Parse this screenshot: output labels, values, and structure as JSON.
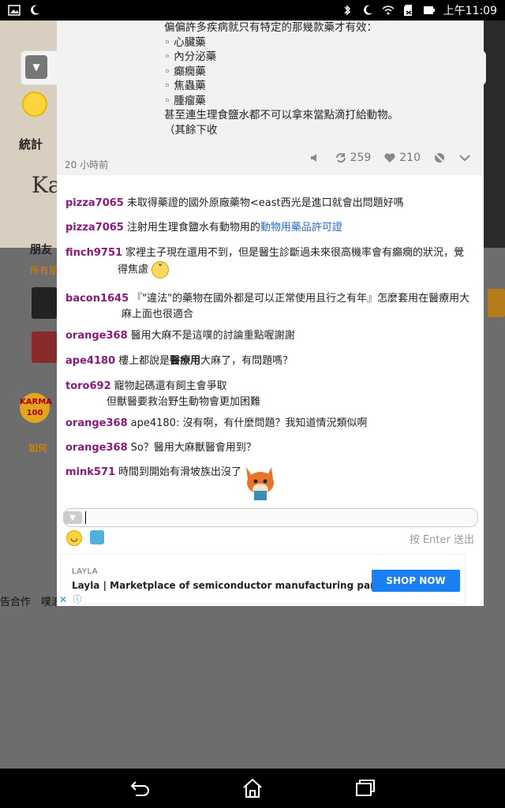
{
  "status_bar": {
    "time": "上午11:09"
  },
  "background": {
    "stats_label": "統計",
    "friends_label": "朋友",
    "all_friends": "所有朋",
    "karma": "KARMA",
    "karma_value": "100",
    "howto": "如何",
    "footer_left": "告合作",
    "footer_mid": "噗浪"
  },
  "post": {
    "lines": [
      "偏偏許多疾病就只有特定的那幾款藥才有效：",
      "◦ 心臟藥",
      "◦ 內分泌藥",
      "◦ 癲癇藥",
      "◦ 焦蟲藥",
      "◦ 腫瘤藥",
      "甚至連生理食鹽水都不可以拿來當點滴打給動物。",
      "（其餘下收"
    ],
    "time_ago": "20 小時前",
    "replurks": "259",
    "likes": "210"
  },
  "comments": [
    {
      "user": "pizza7065",
      "text": "未取得藥證的國外原廠藥物<east西光是進口就會出問題好嗎"
    },
    {
      "user": "pizza7065",
      "text": "注射用生理食鹽水有動物用的",
      "link": "動物用藥品許可證"
    },
    {
      "user": "finch9751",
      "text": "家裡主子現在還用不到，但是醫生診斷過未來很高機率會有癲癇的狀況，覺",
      "text2": "得焦慮"
    },
    {
      "user": "bacon1645",
      "text": "『\"違法\"的藥物在國外都是可以正常使用且行之有年』怎麼套用在醫療用大",
      "text2": "麻上面也很適合"
    },
    {
      "user": "orange368",
      "text": "醫用大麻不是這噗的討論重點喔謝謝"
    },
    {
      "user": "ape4180",
      "text_a": "樓上都說是",
      "bold": "醫療用",
      "text_b": "大麻了，有問題嗎？"
    },
    {
      "user": "toro692",
      "text": "寵物起碼還有飼主會爭取",
      "text2": "但獸醫要救治野生動物會更加困難"
    },
    {
      "user": "orange368",
      "text": "ape4180: 沒有啊，有什麼問題？我知道情況類似啊"
    },
    {
      "user": "orange368",
      "text": "So？醫用大麻獸醫會用到？"
    },
    {
      "user": "mink571",
      "text": "時間到開始有滑坡族出沒了"
    }
  ],
  "compose": {
    "hint": "按 Enter 送出"
  },
  "ad": {
    "brand": "LAYLA",
    "text": "Layla | Marketplace of semiconductor manufacturing parts",
    "button": "SHOP NOW"
  }
}
